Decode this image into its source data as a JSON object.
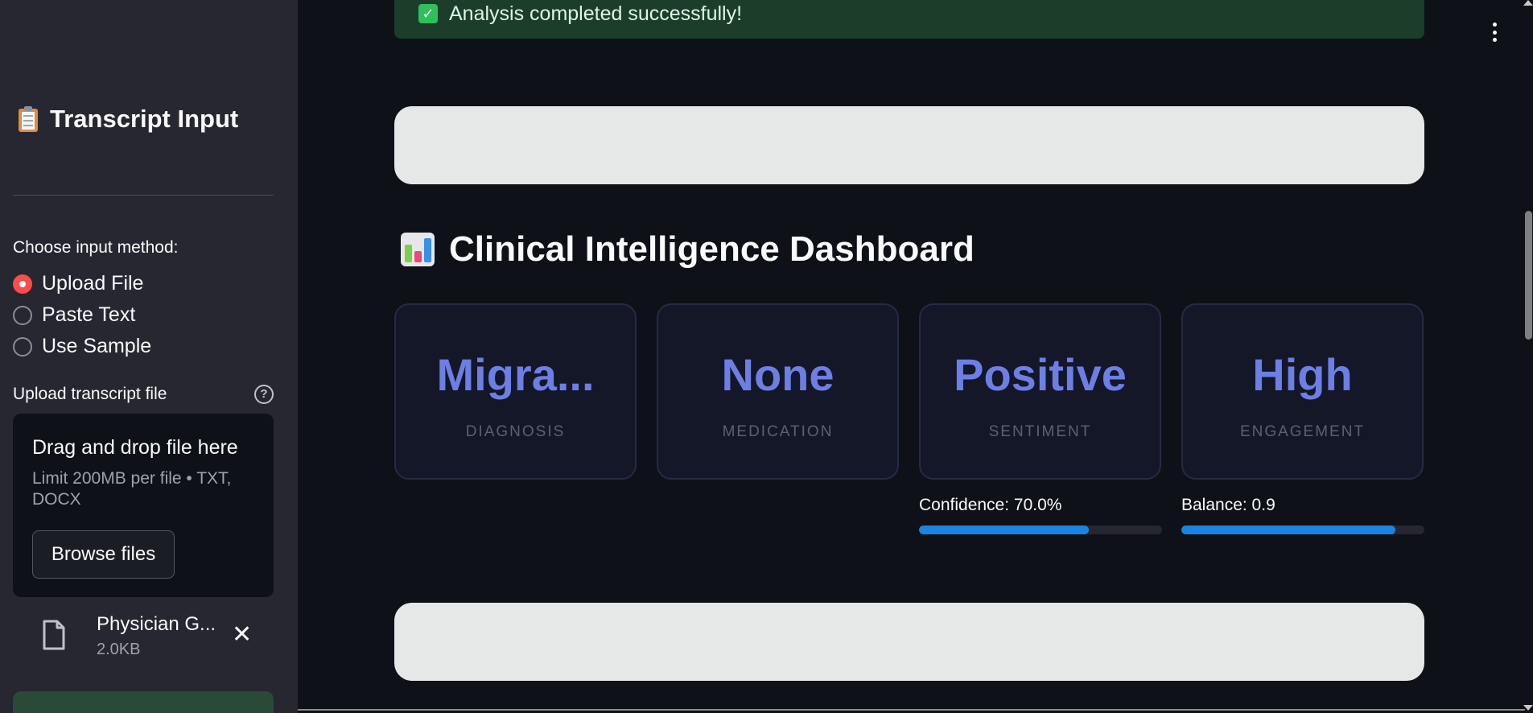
{
  "sidebar": {
    "title": "Transcript Input",
    "title_icon": "clipboard-icon",
    "input_method_label": "Choose input method:",
    "input_options": [
      {
        "label": "Upload File",
        "selected": true
      },
      {
        "label": "Paste Text",
        "selected": false
      },
      {
        "label": "Use Sample",
        "selected": false
      }
    ],
    "upload_label": "Upload transcript file",
    "dropzone": {
      "title": "Drag and drop file here",
      "limit": "Limit 200MB per file • TXT, DOCX",
      "browse_label": "Browse files"
    },
    "file": {
      "name": "Physician G...",
      "size": "2.0KB"
    }
  },
  "main": {
    "success_message": "Analysis completed successfully!",
    "dashboard_title": "Clinical Intelligence Dashboard",
    "dashboard_icon": "bar-chart-icon",
    "cards": [
      {
        "value": "Migra...",
        "label": "DIAGNOSIS"
      },
      {
        "value": "None",
        "label": "MEDICATION"
      },
      {
        "value": "Positive",
        "label": "SENTIMENT"
      },
      {
        "value": "High",
        "label": "ENGAGEMENT"
      }
    ],
    "confidence": {
      "label": "Confidence: 70.0%",
      "fraction": 0.7
    },
    "balance": {
      "label": "Balance: 0.9",
      "fraction": 0.88
    }
  },
  "colors": {
    "accent": "#ff4b4b",
    "card_value": "#6d7ee4",
    "progress": "#1c83e1",
    "success_bg": "#1b3d2a"
  }
}
